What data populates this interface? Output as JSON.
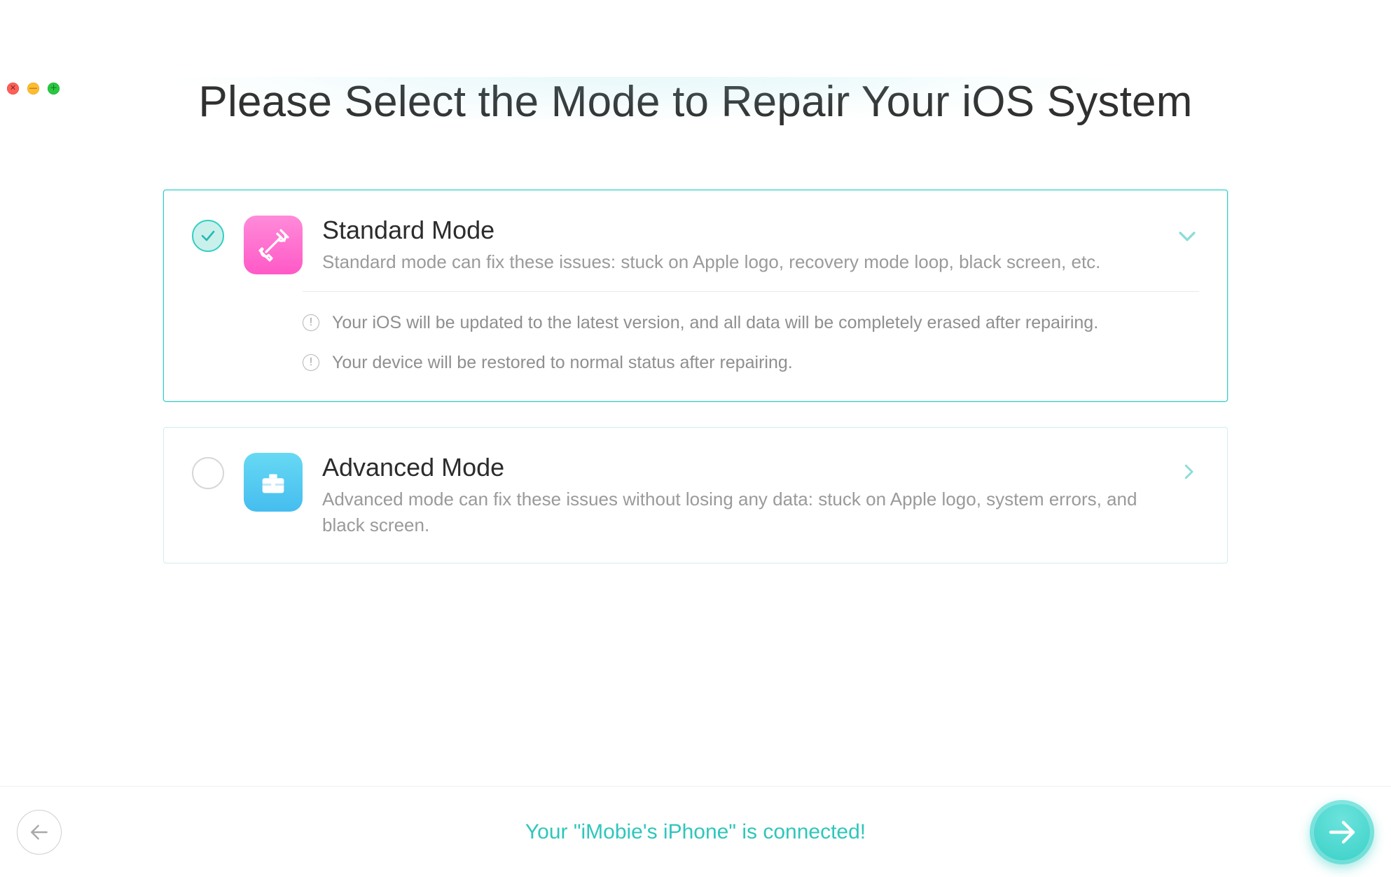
{
  "title": "Please Select the Mode to Repair Your iOS System",
  "modes": {
    "standard": {
      "title": "Standard Mode",
      "description": "Standard mode can fix these issues: stuck on Apple logo, recovery mode loop, black screen, etc.",
      "selected": true,
      "expanded": true,
      "notes": [
        "Your iOS will be updated to the latest version, and all data will be completely erased after repairing.",
        "Your device will be restored to normal status after repairing."
      ]
    },
    "advanced": {
      "title": "Advanced Mode",
      "description": "Advanced mode can fix these issues without losing any data: stuck on Apple logo, system errors, and black screen.",
      "selected": false,
      "expanded": false
    }
  },
  "footer": {
    "status": "Your \"iMobie's iPhone\" is connected!"
  }
}
